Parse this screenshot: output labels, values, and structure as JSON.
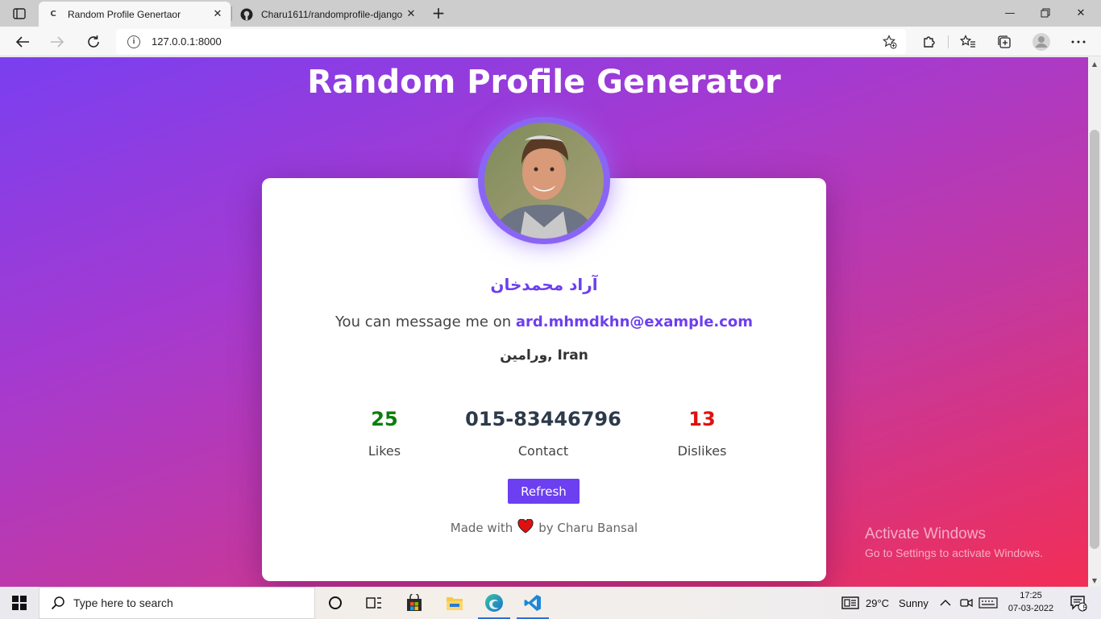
{
  "browser": {
    "tabs": [
      {
        "title": "Random Profile Genertaor",
        "favicon": "C"
      },
      {
        "title": "Charu1611/randomprofile-django"
      }
    ],
    "url": "127.0.0.1:8000"
  },
  "page": {
    "title": "Random Profile Generator",
    "profile": {
      "name": "آراد محمدخان",
      "message_prefix": "You can message me on",
      "email": "ard.mhmdkhn@example.com",
      "location": "ورامین, Iran"
    },
    "stats": {
      "likes": {
        "value": "25",
        "label": "Likes",
        "color": "#0a7d0a"
      },
      "contact": {
        "value": "015-83446796",
        "label": "Contact",
        "color": "#2d3a4a"
      },
      "dislikes": {
        "value": "13",
        "label": "Dislikes",
        "color": "#e01010"
      }
    },
    "refresh_label": "Refresh",
    "footer": {
      "prefix": "Made with",
      "suffix": "by Charu Bansal"
    },
    "accent_color": "#6c3ff0"
  },
  "watermark": {
    "line1": "Activate Windows",
    "line2": "Go to Settings to activate Windows."
  },
  "taskbar": {
    "search_placeholder": "Type here to search",
    "weather": {
      "temp": "29°C",
      "condition": "Sunny"
    },
    "time": "17:25",
    "date": "07-03-2022",
    "notification_count": "5"
  }
}
